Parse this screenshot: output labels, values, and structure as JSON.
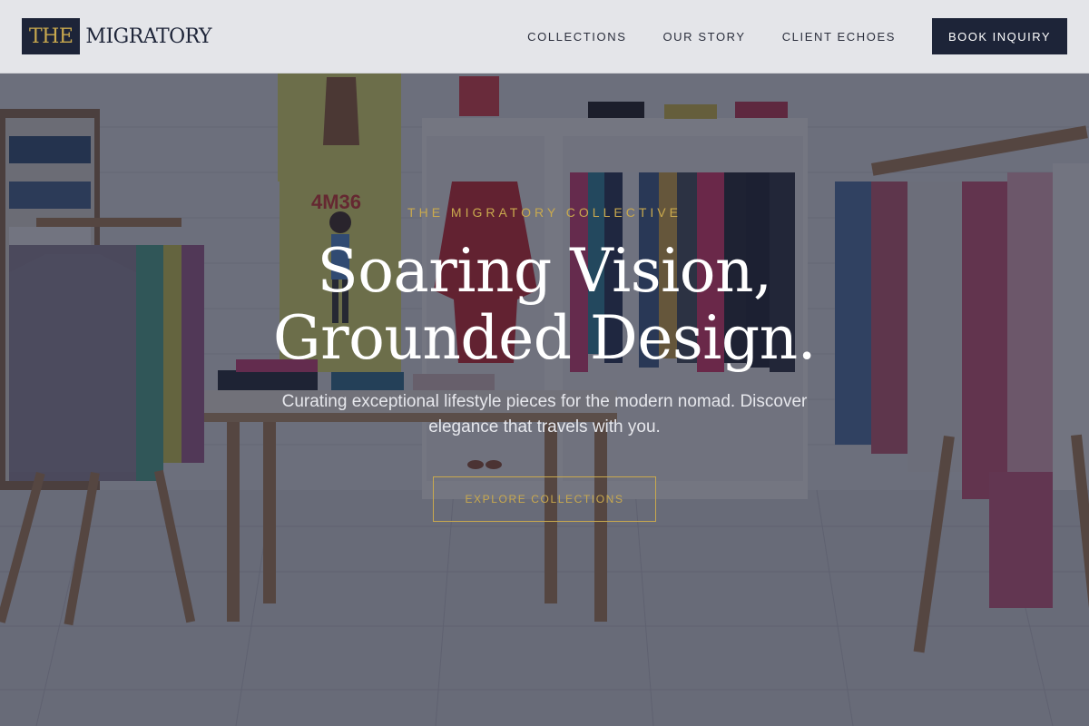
{
  "brand": {
    "logo_highlight": "THE",
    "logo_rest": "MIGRATORY"
  },
  "nav": {
    "items": [
      {
        "label": "COLLECTIONS"
      },
      {
        "label": "OUR STORY"
      },
      {
        "label": "CLIENT ECHOES"
      }
    ],
    "cta_label": "BOOK INQUIRY"
  },
  "hero": {
    "eyebrow": "THE MIGRATORY COLLECTIVE",
    "headline_line1": "Soaring Vision,",
    "headline_line2": "Grounded Design.",
    "subtext": "Curating exceptional lifestyle pieces for the modern nomad. Discover elegance that travels with you.",
    "button_label": "EXPLORE COLLECTIONS",
    "background": "boutique-interior-photo",
    "poster_text": "4M36"
  },
  "colors": {
    "navy": "#1d2438",
    "gold": "#c9a94e",
    "header_bg": "#ecedf0",
    "white": "#ffffff"
  }
}
